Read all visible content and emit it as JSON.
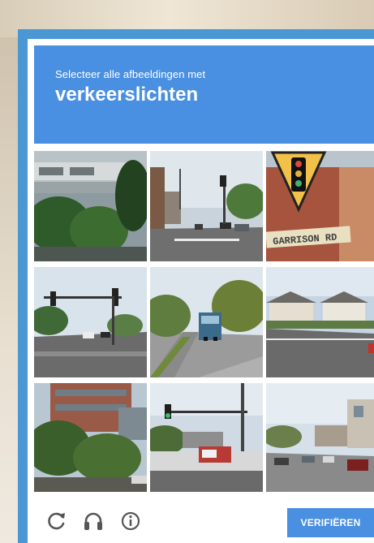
{
  "challenge": {
    "instruction": "Selecteer alle afbeeldingen met",
    "keyword": "verkeerslichten"
  },
  "grid": {
    "tiles": [
      {
        "row": 1,
        "col": 1,
        "scene": "parking garage with trees"
      },
      {
        "row": 1,
        "col": 2,
        "scene": "street intersection with traffic lights"
      },
      {
        "row": 1,
        "col": 3,
        "scene": "traffic signal warning sign",
        "sign_text": "GARRISON RD"
      },
      {
        "row": 2,
        "col": 1,
        "scene": "road with traffic lights"
      },
      {
        "row": 2,
        "col": 2,
        "scene": "road with bus"
      },
      {
        "row": 2,
        "col": 3,
        "scene": "houses along road"
      },
      {
        "row": 3,
        "col": 1,
        "scene": "trees and building"
      },
      {
        "row": 3,
        "col": 2,
        "scene": "traffic light over road"
      },
      {
        "row": 3,
        "col": 3,
        "scene": "street with parked cars"
      }
    ]
  },
  "footer": {
    "icons": [
      "reload-icon",
      "headphones-icon",
      "info-icon"
    ],
    "verify_label": "VERIFIËREN"
  },
  "colors": {
    "header_blue": "#4a90e2",
    "frame_blue": "#4a97d3",
    "icon_gray": "#555555"
  }
}
